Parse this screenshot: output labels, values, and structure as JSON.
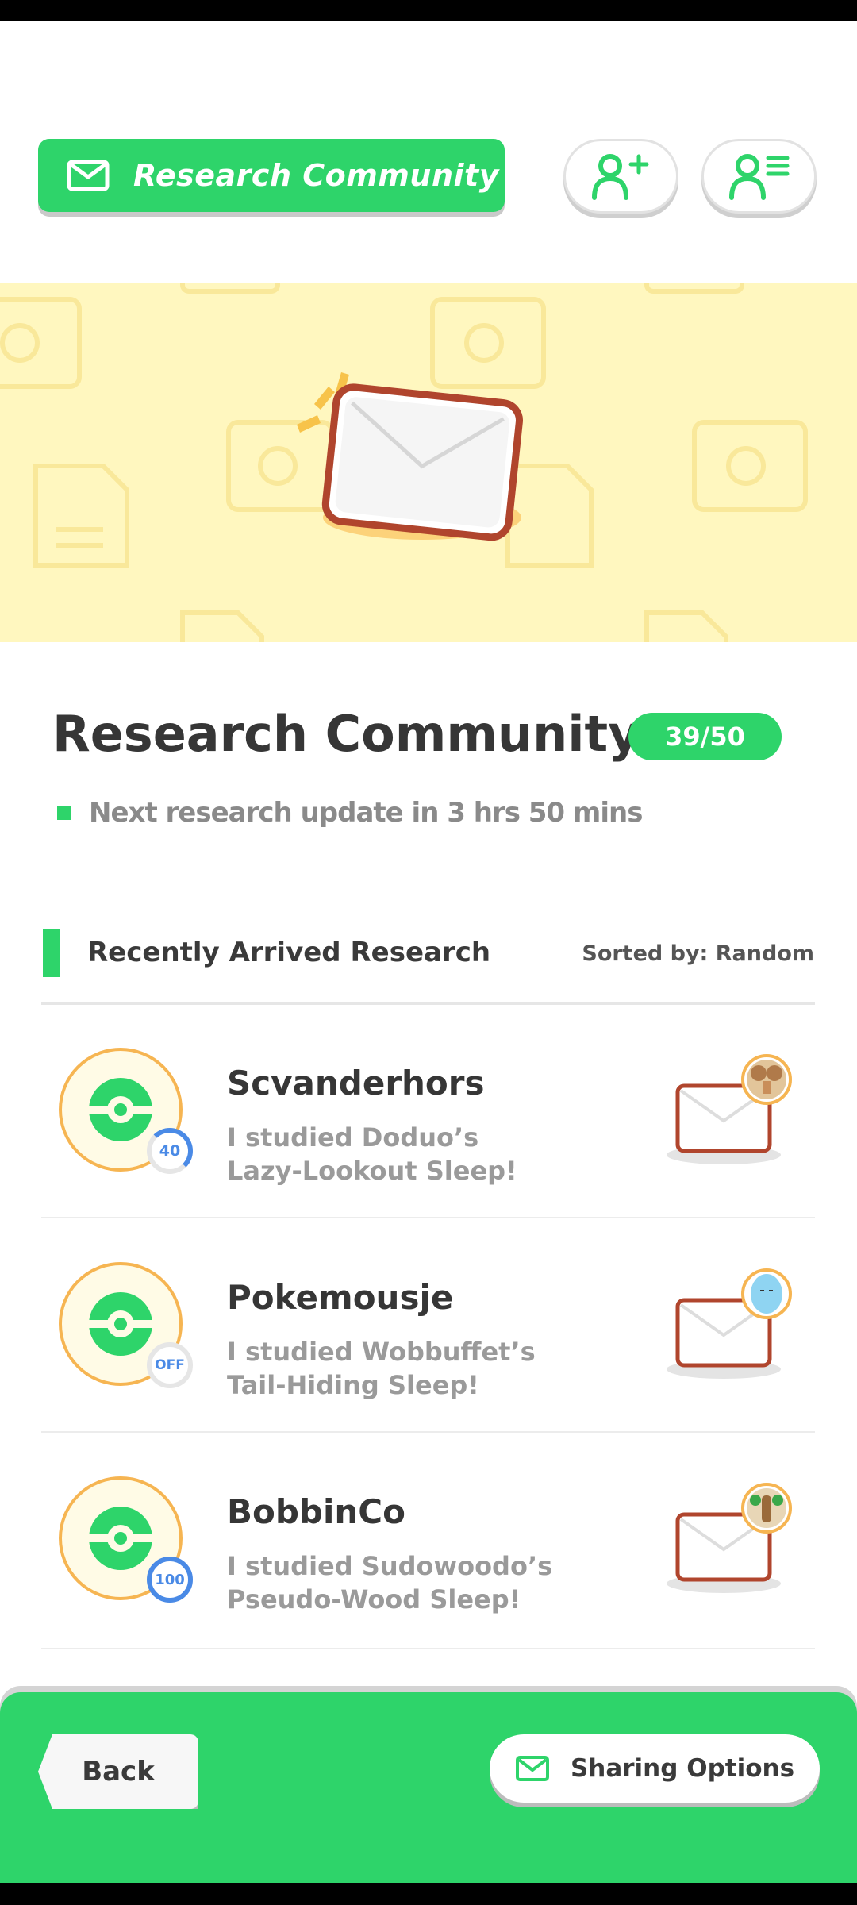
{
  "header": {
    "title": "Research Community",
    "add_friend_icon": "add-person-icon",
    "friend_list_icon": "person-list-icon"
  },
  "banner": {
    "image": "envelope-illustration"
  },
  "community": {
    "title": "Research Community",
    "count": "39/50",
    "update_text": "Next research update in 3 hrs 50 mins"
  },
  "section": {
    "title": "Recently Arrived Research",
    "sorted_by": "Sorted by: Random"
  },
  "research_items": [
    {
      "name": "Scvanderhors",
      "desc_line1": "I studied Doduo’s",
      "desc_line2": "Lazy-Lookout Sleep!",
      "level": "40",
      "pokemon": "doduo"
    },
    {
      "name": "Pokemousje",
      "desc_line1": "I studied Wobbuffet’s",
      "desc_line2": "Tail-Hiding Sleep!",
      "level": "OFF",
      "pokemon": "wobbuffet"
    },
    {
      "name": "BobbinCo",
      "desc_line1": "I studied Sudowoodo’s",
      "desc_line2": "Pseudo-Wood Sleep!",
      "level": "100",
      "pokemon": "sudowoodo"
    }
  ],
  "footer": {
    "back_label": "Back",
    "share_label": "Sharing Options"
  },
  "colors": {
    "accent_green": "#2ed46a",
    "banner_yellow": "#fff7bf",
    "ring_orange": "#f6b552",
    "badge_blue": "#4a8ae6",
    "envelope_brown": "#b0452d"
  }
}
